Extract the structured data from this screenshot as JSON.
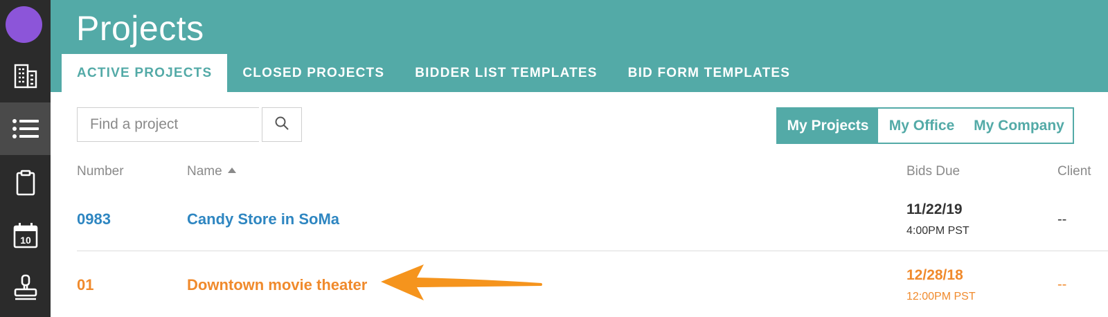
{
  "header": {
    "title": "Projects",
    "tabs": [
      {
        "label": "ACTIVE PROJECTS",
        "active": true
      },
      {
        "label": "CLOSED PROJECTS",
        "active": false
      },
      {
        "label": "BIDDER LIST TEMPLATES",
        "active": false
      },
      {
        "label": "BID FORM TEMPLATES",
        "active": false
      }
    ]
  },
  "sidebar": {
    "items": [
      {
        "icon": "building-icon"
      },
      {
        "icon": "list-icon",
        "active": true
      },
      {
        "icon": "clipboard-icon"
      },
      {
        "icon": "calendar-icon",
        "label": "10"
      },
      {
        "icon": "stamp-icon"
      }
    ]
  },
  "search": {
    "placeholder": "Find a project",
    "value": ""
  },
  "filter": {
    "options": [
      "My Projects",
      "My Office",
      "My Company"
    ],
    "selected": "My Projects"
  },
  "table": {
    "columns": {
      "number": "Number",
      "name": "Name",
      "bids_due": "Bids Due",
      "client": "Client"
    },
    "rows": [
      {
        "number": "0983",
        "name": "Candy Store in SoMa",
        "due_date": "11/22/19",
        "due_time": "4:00PM PST",
        "client": "--"
      },
      {
        "number": "01",
        "name": "Downtown movie theater",
        "due_date": "12/28/18",
        "due_time": "12:00PM PST",
        "client": "--"
      }
    ]
  },
  "colors": {
    "brand": "#53aaa7",
    "link": "#2e86c1",
    "highlight": "#f08a2c",
    "sidebar": "#2b2b2b",
    "avatar": "#8c55d9"
  }
}
